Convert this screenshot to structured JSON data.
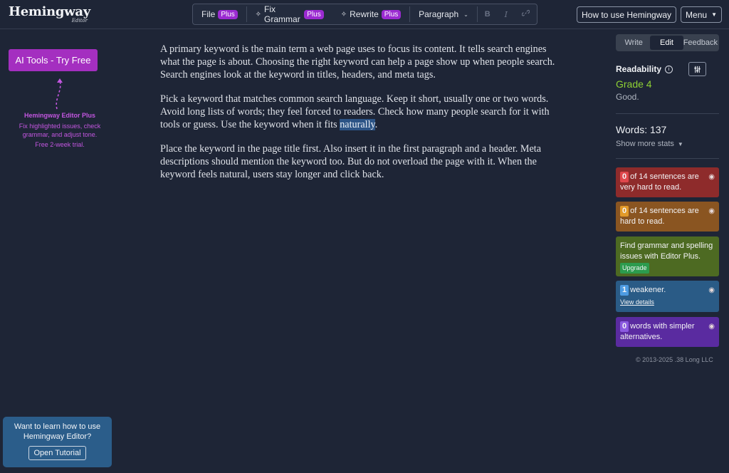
{
  "app": {
    "logo_title": "Hemingway",
    "logo_subtitle": "Editor"
  },
  "toolbar": {
    "file_label": "File",
    "fix_grammar_label": "Fix Grammar",
    "rewrite_label": "Rewrite",
    "plus_badge": "Plus",
    "paragraph_label": "Paragraph",
    "bold_label": "B",
    "italic_label": "I",
    "link_icon": "link-icon"
  },
  "header": {
    "how_to_label": "How to use Hemingway",
    "menu_label": "Menu"
  },
  "left": {
    "ai_tools_label": "AI Tools - Try Free",
    "promo_title": "Hemingway Editor Plus",
    "promo_desc": "Fix highlighted issues, check grammar, and adjust tone.",
    "promo_trial": "Free 2-week trial.",
    "tutorial_text": "Want to learn how to use Hemingway Editor?",
    "tutorial_button": "Open Tutorial"
  },
  "document": {
    "p1": "A primary keyword is the main term a web page uses to focus its content. It tells search engines what the page is about. Choosing the right keyword can help a page show up when people search. Search engines look at the keyword in titles, headers, and meta tags.",
    "p2_before": "Pick a keyword that matches common search language. Keep it short, usually one or two words. Avoid long lists of words; they feel forced to readers. Check how many people search for it with tools or guess. Use the keyword when it fits ",
    "p2_highlight": "naturally",
    "p2_after": ".",
    "p3": "Place the keyword in the page title first. Also insert it in the first paragraph and a header. Meta descriptions should mention the keyword too. But do not overload the page with it. When the keyword feels natural, users stay longer and click back."
  },
  "sidebar": {
    "tabs": [
      {
        "label": "Write"
      },
      {
        "label": "Edit"
      },
      {
        "label": "Feedback"
      }
    ],
    "readability_label": "Readability",
    "grade": "Grade 4",
    "grade_desc": "Good.",
    "words": "Words: 137",
    "show_more": "Show more stats",
    "cards": {
      "very_hard_count": "0",
      "very_hard_text": "of 14 sentences are very hard to read.",
      "hard_count": "0",
      "hard_text": "of 14 sentences are hard to read.",
      "grammar_text": "Find grammar and spelling issues with Editor Plus.",
      "upgrade_label": "Upgrade",
      "weakener_count": "1",
      "weakener_text": "weakener.",
      "view_details": "View details",
      "simpler_count": "0",
      "simpler_text": "words with simpler alternatives."
    },
    "copyright": "© 2013-2025 .38 Long LLC"
  },
  "colors": {
    "background": "#1e2536",
    "plus_badge": "#9b2bd1",
    "grade": "#8ed134",
    "very_hard": "#8e2b2b",
    "hard": "#8a5521",
    "grammar": "#4d6a22",
    "weakener": "#2a5b86",
    "simpler": "#5a2ba0"
  }
}
